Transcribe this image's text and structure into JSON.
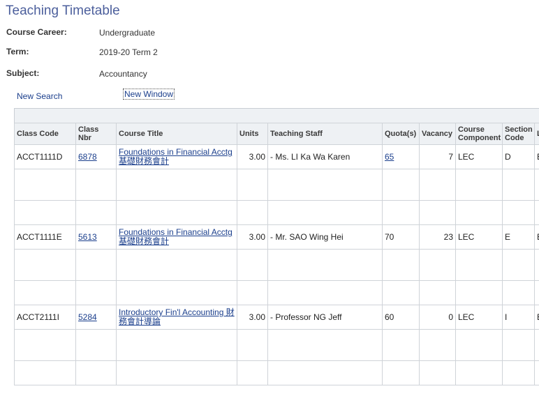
{
  "page": {
    "title": "Teaching Timetable"
  },
  "filters": {
    "career_label": "Course Career:",
    "career_value": "Undergraduate",
    "term_label": "Term:",
    "term_value": "2019-20 Term 2",
    "subject_label": "Subject:",
    "subject_value": "Accountancy"
  },
  "links": {
    "new_search": "New Search",
    "new_window": "New Window"
  },
  "table": {
    "headers": {
      "class_code": "Class Code",
      "class_nbr": "Class Nbr",
      "course_title": "Course Title",
      "units": "Units",
      "teaching_staff": "Teaching Staff",
      "quota": "Quota(s)",
      "vacancy": "Vacancy",
      "course_component": "Course Component",
      "section_code": "Section Code",
      "next": "L"
    },
    "rows": [
      {
        "class_code": "ACCT1111D",
        "class_nbr": "6878",
        "course_title": "Foundations in Financial Acctg 基礎財務會計",
        "units": "3.00",
        "teaching_staff": "- Ms. LI Ka Wa Karen",
        "quota": "65",
        "vacancy": "7",
        "course_component": "LEC",
        "section_code": "D",
        "next": "E"
      },
      {
        "class_code": "ACCT1111E",
        "class_nbr": "5613",
        "course_title": "Foundations in Financial Acctg 基礎財務會計",
        "units": "3.00",
        "teaching_staff": "- Mr. SAO Wing Hei",
        "quota": "70",
        "vacancy": "23",
        "course_component": "LEC",
        "section_code": "E",
        "next": "E"
      },
      {
        "class_code": "ACCT2111I",
        "class_nbr": "5284",
        "course_title": "Introductory Fin'l Accounting 財務會計導論",
        "units": "3.00",
        "teaching_staff": "- Professor NG Jeff",
        "quota": "60",
        "vacancy": "0",
        "course_component": "LEC",
        "section_code": "I",
        "next": "E"
      }
    ]
  }
}
